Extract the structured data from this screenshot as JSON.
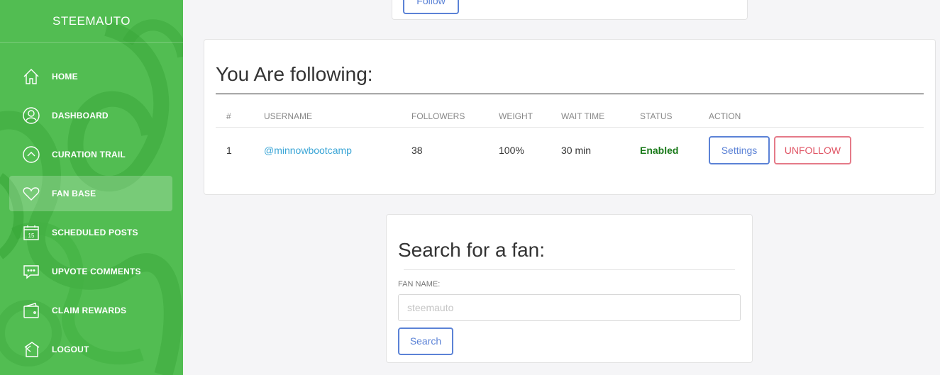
{
  "sidebar": {
    "brand": "STEEMAUTO",
    "items": [
      {
        "label": "HOME",
        "icon": "home-icon"
      },
      {
        "label": "DASHBOARD",
        "icon": "user-circle-icon"
      },
      {
        "label": "CURATION TRAIL",
        "icon": "chevron-up-circle-icon"
      },
      {
        "label": "FAN BASE",
        "icon": "heart-icon",
        "active": true
      },
      {
        "label": "SCHEDULED POSTS",
        "icon": "calendar-icon",
        "calendar_day": "15"
      },
      {
        "label": "UPVOTE COMMENTS",
        "icon": "comment-icon"
      },
      {
        "label": "CLAIM REWARDS",
        "icon": "wallet-icon"
      },
      {
        "label": "LOGOUT",
        "icon": "logout-icon"
      }
    ]
  },
  "top_card": {
    "button_label": "Follow"
  },
  "following": {
    "title": "You Are following:",
    "columns": [
      "#",
      "USERNAME",
      "FOLLOWERS",
      "WEIGHT",
      "WAIT TIME",
      "STATUS",
      "ACTION"
    ],
    "rows": [
      {
        "num": "1",
        "username": "@minnowbootcamp",
        "followers": "38",
        "weight": "100%",
        "wait_time": "30 min",
        "status": "Enabled",
        "settings_label": "Settings",
        "unfollow_label": "UNFOLLOW"
      }
    ]
  },
  "search": {
    "title": "Search for a fan:",
    "field_label": "FAN NAME:",
    "placeholder": "steemauto",
    "value": "",
    "button_label": "Search"
  },
  "colors": {
    "sidebar_green": "#4cb84c",
    "link": "#3aa5d6",
    "status_enabled": "#1a7a1a",
    "primary_outline": "#5b82d6",
    "danger_outline": "#e57a88"
  }
}
